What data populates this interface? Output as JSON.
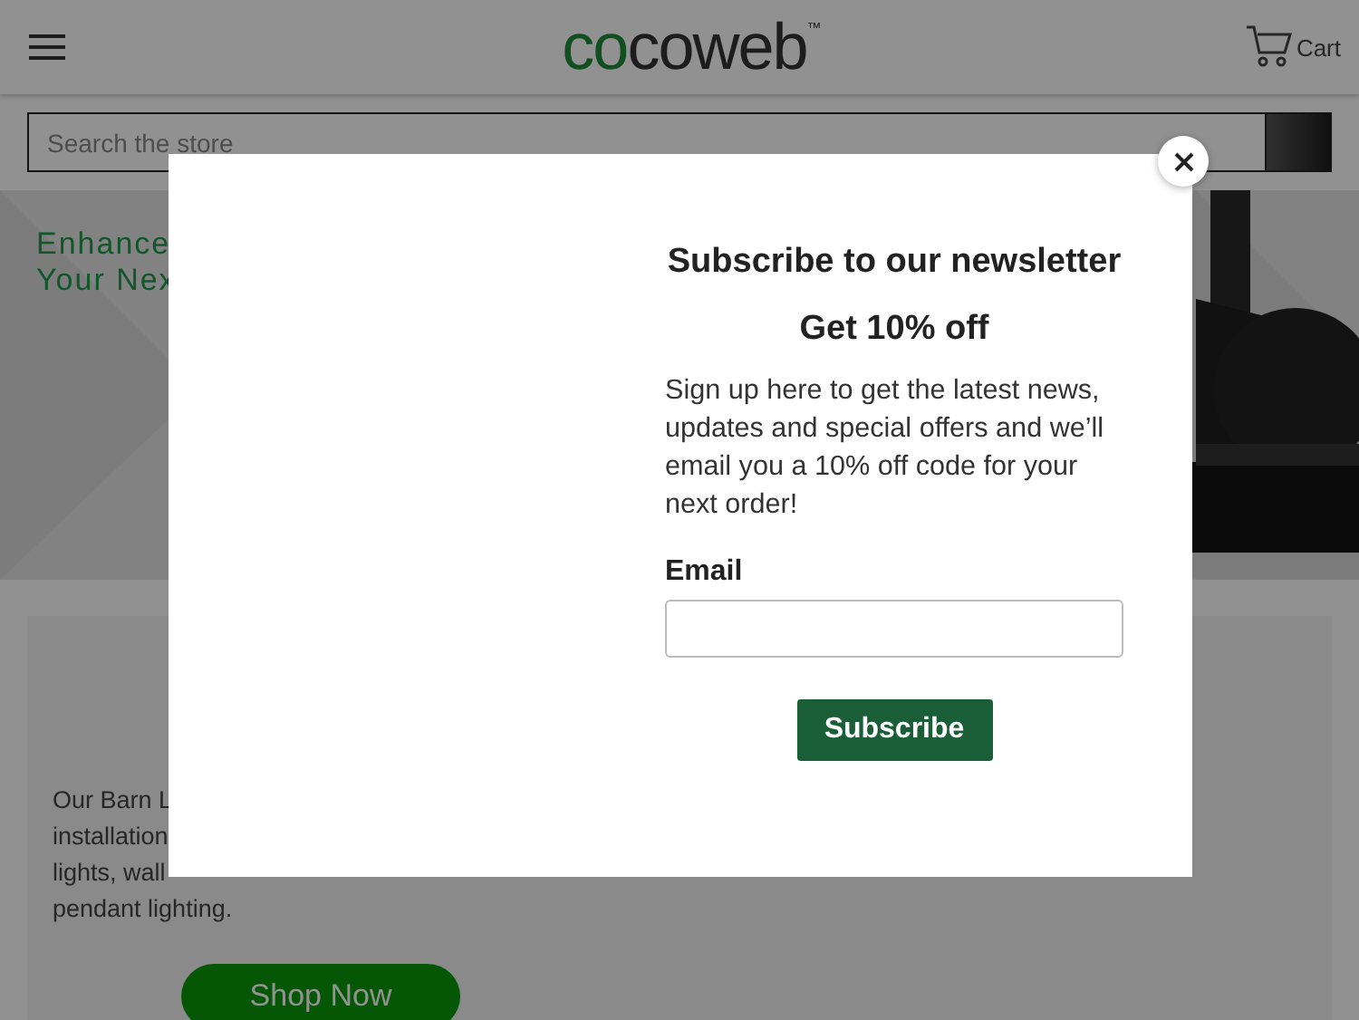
{
  "header": {
    "logo": {
      "accent": "co",
      "rest": "coweb",
      "mark": "™"
    },
    "cart_label": "Cart"
  },
  "search": {
    "placeholder": "Search the store"
  },
  "hero": {
    "lines": [
      "Enhance",
      "Your Nex"
    ]
  },
  "promo": {
    "lines": [
      "Our Barn L",
      "installation",
      "lights, wall",
      "pendant lighting."
    ],
    "button": "Shop Now"
  },
  "modal": {
    "open": true,
    "title": "Subscribe to our newsletter",
    "subtitle": "Get 10% off",
    "body": "Sign up here to get the latest news, updates and special offers and we’ll email you a 10% off code for your next order!",
    "email_label": "Email",
    "button": "Subscribe"
  }
}
